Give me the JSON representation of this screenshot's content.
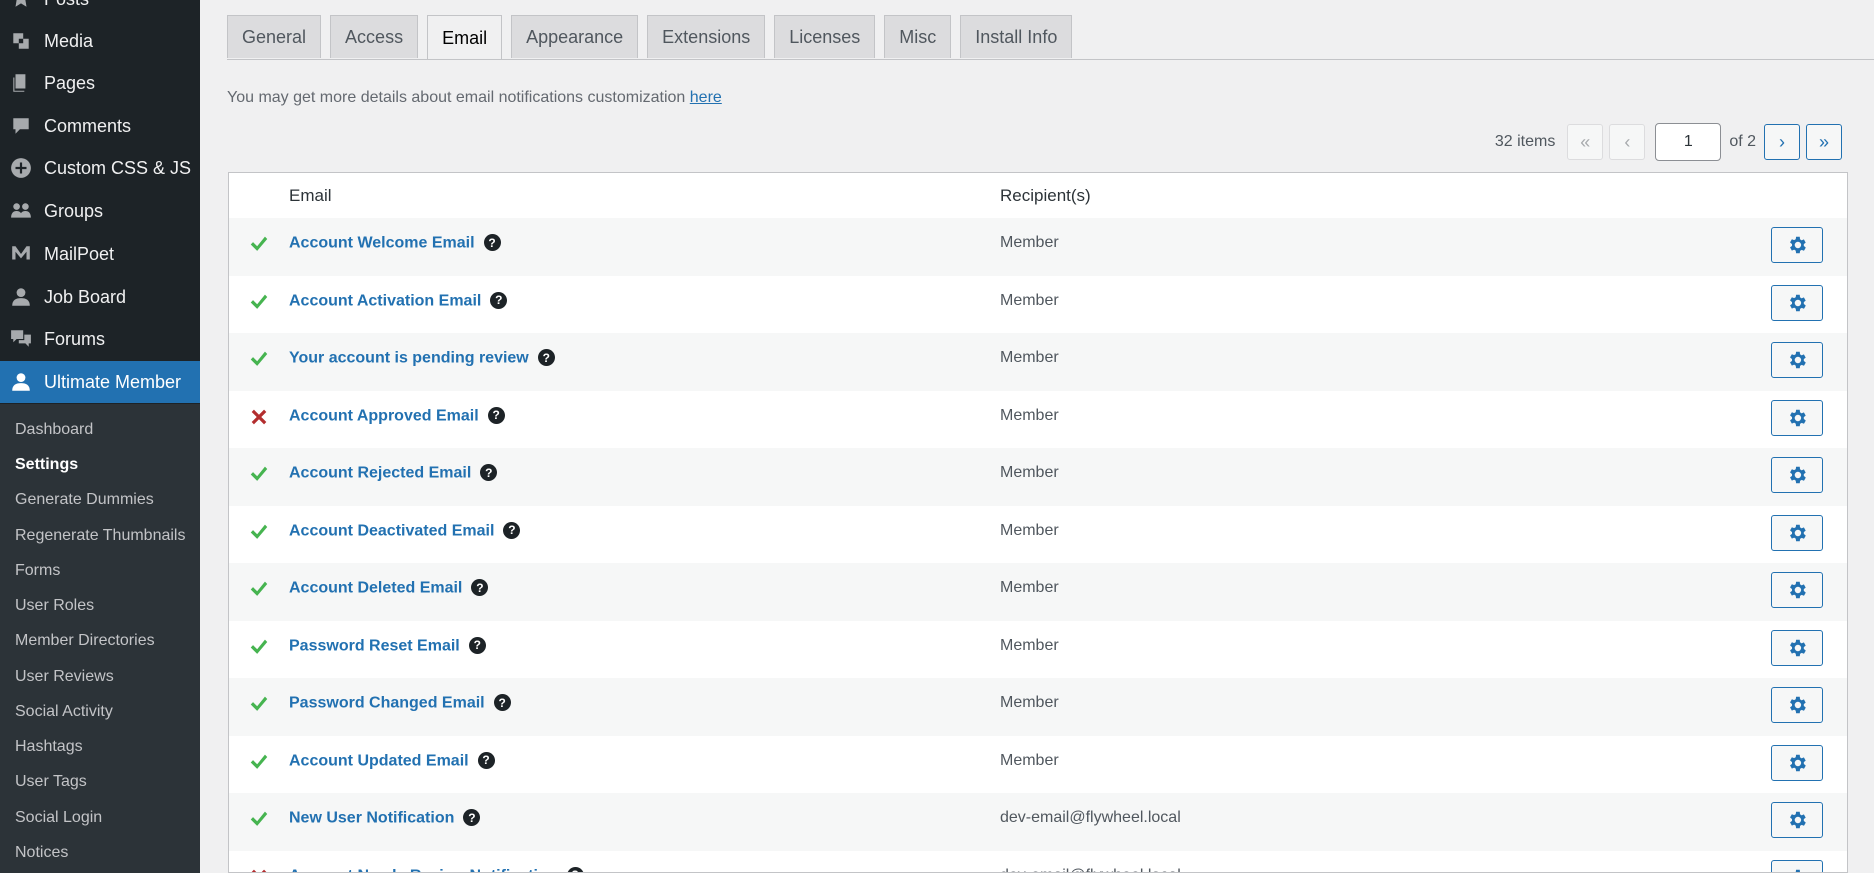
{
  "sidebar": {
    "menu": [
      {
        "label": "Posts",
        "icon": "pin-icon"
      },
      {
        "label": "Media",
        "icon": "media-icon"
      },
      {
        "label": "Pages",
        "icon": "pages-icon"
      },
      {
        "label": "Comments",
        "icon": "comments-icon"
      },
      {
        "label": "Custom CSS & JS",
        "icon": "plus-circle-icon"
      },
      {
        "label": "Groups",
        "icon": "groups-icon"
      },
      {
        "label": "MailPoet",
        "icon": "mailpoet-icon"
      },
      {
        "label": "Job Board",
        "icon": "user-icon"
      },
      {
        "label": "Forums",
        "icon": "forums-icon"
      },
      {
        "label": "Ultimate Member",
        "icon": "user-icon"
      }
    ],
    "submenu": [
      "Dashboard",
      "Settings",
      "Generate Dummies",
      "Regenerate Thumbnails",
      "Forms",
      "User Roles",
      "Member Directories",
      "User Reviews",
      "Social Activity",
      "Hashtags",
      "User Tags",
      "Social Login",
      "Notices"
    ]
  },
  "tabs": [
    "General",
    "Access",
    "Email",
    "Appearance",
    "Extensions",
    "Licenses",
    "Misc",
    "Install Info"
  ],
  "intro": {
    "text": "You may get more details about email notifications customization",
    "link": "here"
  },
  "pagination": {
    "count": "32 items",
    "first": "«",
    "prev": "‹",
    "current": "1",
    "of": "of 2",
    "next": "›",
    "last": "»"
  },
  "table": {
    "headers": {
      "email": "Email",
      "recipients": "Recipient(s)"
    },
    "rows": [
      {
        "name": "Account Welcome Email",
        "recipient": "Member",
        "enabled": true
      },
      {
        "name": "Account Activation Email",
        "recipient": "Member",
        "enabled": true
      },
      {
        "name": "Your account is pending review",
        "recipient": "Member",
        "enabled": true
      },
      {
        "name": "Account Approved Email",
        "recipient": "Member",
        "enabled": false
      },
      {
        "name": "Account Rejected Email",
        "recipient": "Member",
        "enabled": true
      },
      {
        "name": "Account Deactivated Email",
        "recipient": "Member",
        "enabled": true
      },
      {
        "name": "Account Deleted Email",
        "recipient": "Member",
        "enabled": true
      },
      {
        "name": "Password Reset Email",
        "recipient": "Member",
        "enabled": true
      },
      {
        "name": "Password Changed Email",
        "recipient": "Member",
        "enabled": true
      },
      {
        "name": "Account Updated Email",
        "recipient": "Member",
        "enabled": true
      },
      {
        "name": "New User Notification",
        "recipient": "dev-email@flywheel.local",
        "enabled": true
      },
      {
        "name": "Account Needs Review Notification",
        "recipient": "dev-email@flywheel.local",
        "enabled": false
      }
    ],
    "help_glyph": "?"
  },
  "colors": {
    "sidebar_bg": "#1d2327",
    "submenu_bg": "#2c3338",
    "accent": "#2271b1",
    "enabled_check": "#46b450",
    "disabled_cross": "#b32d2e"
  }
}
